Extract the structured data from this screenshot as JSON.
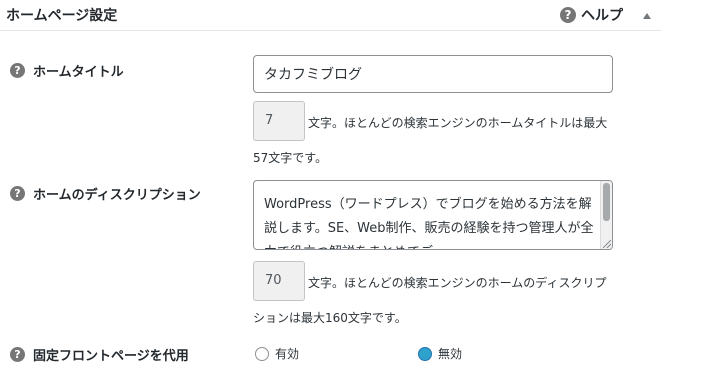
{
  "panel": {
    "title": "ホームページ設定",
    "help_label": "ヘルプ",
    "help_icon": "?"
  },
  "fields": {
    "home_title": {
      "label": "ホームタイトル",
      "value": "タカフミブログ",
      "count": "7",
      "desc_line1": "文字。ほとんどの検索エンジンのホームタイトルは最大",
      "desc_line2": "57文字です。"
    },
    "home_description": {
      "label": "ホームのディスクリプション",
      "value": "WordPress（ワードプレス）でブログを始める方法を解説します。SE、Web制作、販売の経験を持つ管理人が全力で役立つ解説をまとめてご…",
      "count": "70",
      "desc_line1": "文字。ほとんどの検索エンジンのホームのディスクリプ",
      "desc_line2": "ションは最大160文字です。"
    },
    "static_front_page": {
      "label": "固定フロントページを代用",
      "options": [
        {
          "label": "有効",
          "checked": false
        },
        {
          "label": "無効",
          "checked": true
        }
      ]
    }
  },
  "colors": {
    "radio_checked": "#2ea2cc",
    "help_icon": "#767676"
  }
}
